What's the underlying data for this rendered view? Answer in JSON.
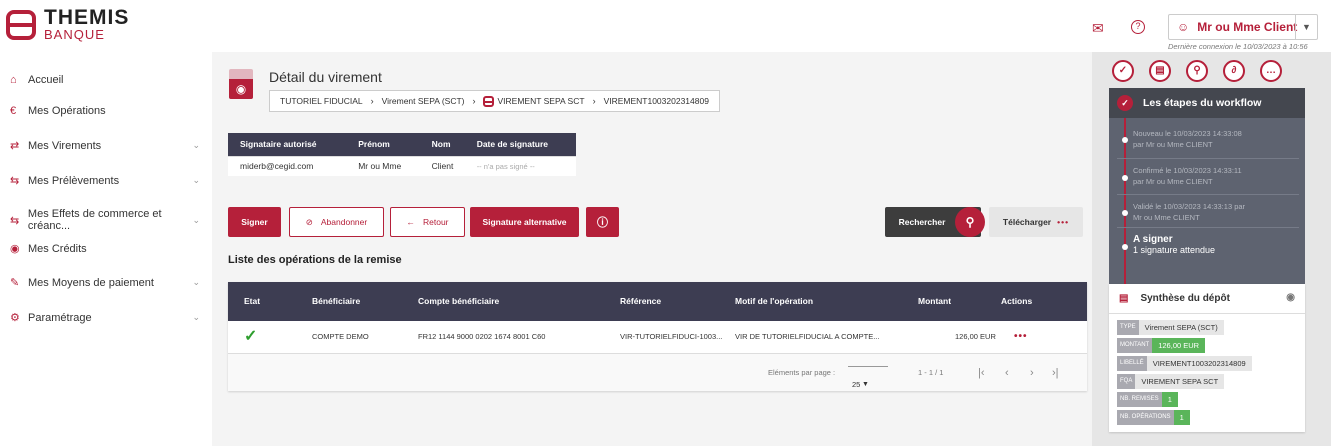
{
  "brand": {
    "name_line1": "THEMIS",
    "name_line2": "BANQUE"
  },
  "header": {
    "user_label": "Mr ou Mme Client",
    "last_login": "Dernière connexion le 10/03/2023 à 10:56"
  },
  "sidebar": {
    "items": [
      {
        "label": "Accueil",
        "icon": "⌂"
      },
      {
        "label": "Mes Opérations",
        "icon": "€"
      },
      {
        "label": "Mes Virements",
        "icon": "⇄",
        "chevron": "⌄"
      },
      {
        "label": "Mes Prélèvements",
        "icon": "⇆",
        "chevron": "⌄"
      },
      {
        "label": "Mes Effets de commerce et créanc...",
        "icon": "⇆",
        "chevron": "⌄"
      },
      {
        "label": "Mes Crédits",
        "icon": "◉"
      },
      {
        "label": "Mes Moyens de paiement",
        "icon": "✎",
        "chevron": "⌄"
      },
      {
        "label": "Paramétrage",
        "icon": "⚙",
        "chevron": "⌄"
      }
    ]
  },
  "page": {
    "title": "Détail du virement",
    "breadcrumb": [
      "TUTORIEL FIDUCIAL",
      "Virement SEPA (SCT)",
      "VIREMENT SEPA SCT",
      "VIREMENT1003202314809"
    ]
  },
  "signature_table": {
    "headers": [
      "Signataire autorisé",
      "Prénom",
      "Nom",
      "Date de signature"
    ],
    "row": [
      "miderb@cegid.com",
      "Mr ou Mme",
      "Client",
      "-- n'a pas signé --"
    ]
  },
  "actions": {
    "sign": "Signer",
    "abandon": "Abandonner",
    "back": "Retour",
    "alt_signature": "Signature alternative",
    "search": "Rechercher",
    "download": "Télécharger"
  },
  "operations": {
    "title": "Liste des opérations de la remise",
    "headers": [
      "Etat",
      "Bénéficiaire",
      "Compte bénéficiaire",
      "Référence",
      "Motif de l'opération",
      "Montant",
      "Actions"
    ],
    "rows": [
      {
        "beneficiary": "COMPTE DEMO",
        "account": "FR12 1144 9000 0202 1674 8001 C60",
        "reference": "VIR-TUTORIELFIDUCI-1003...",
        "motif": "VIR DE TUTORIELFIDUCIAL A COMPTE...",
        "amount": "126,00 EUR"
      }
    ],
    "footer": {
      "per_page_label": "Eléments par page :",
      "per_page_value": "25",
      "range": "1 - 1 / 1"
    }
  },
  "workflow": {
    "title": "Les étapes du workflow",
    "steps": [
      {
        "line1": "Nouveau le 10/03/2023 14:33:08",
        "line2": "par Mr ou Mme CLIENT"
      },
      {
        "line1": "Confirmé le 10/03/2023 14:33:11",
        "line2": "par Mr ou Mme CLIENT"
      },
      {
        "line1": "Validé le 10/03/2023 14:33:13 par",
        "line2": "Mr ou Mme CLIENT"
      }
    ],
    "current": {
      "title": "A signer",
      "subtitle": "1 signature attendue"
    }
  },
  "synthese": {
    "title": "Synthèse du dépôt",
    "type_k": "TYPE",
    "type_v": "Virement SEPA (SCT)",
    "montant_k": "MONTANT",
    "montant_v": "126,00 EUR",
    "libelle_k": "LIBELLÉ",
    "libelle_v": "VIREMENT1003202314809",
    "fqa_k": "FQA",
    "fqa_v": "VIREMENT SEPA SCT",
    "remises_k": "NB. REMISES",
    "remises_v": "1",
    "ops_k": "NB. OPÉRATIONS",
    "ops_v": "1"
  },
  "colors": {
    "accent": "#b5203a",
    "dark_header": "#3d3d52",
    "panel": "#5e6370",
    "success": "#5ab55a"
  }
}
